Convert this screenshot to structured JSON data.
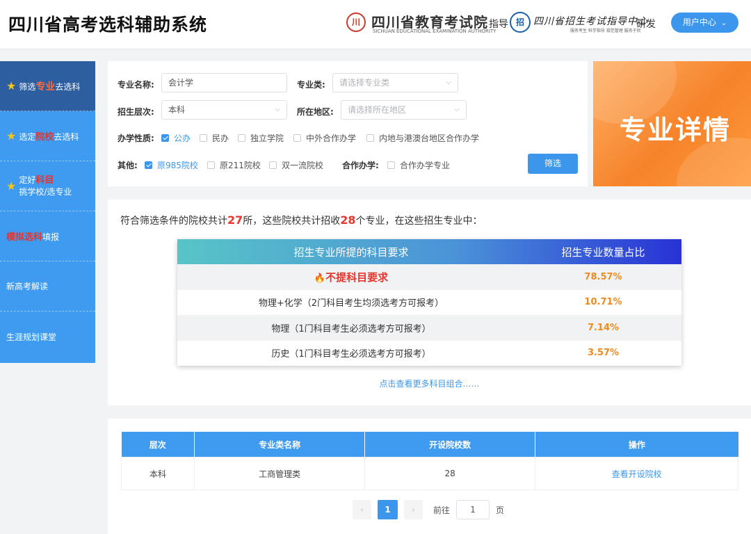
{
  "header": {
    "app_title": "四川省高考选科辅助系统",
    "org1_logo_text": "川",
    "org1_name": "四川省教育考试院",
    "org1_en": "SICHUAN EDUCATIONAL EXAMINATION AUTHORITY",
    "guide_text": "指导",
    "org2_logo_text": "招",
    "org2_name": "四川省招生考试指导中心",
    "org2_sub": "服务考生  科学指导  规范管理  服务于民",
    "develop_text": "研发",
    "user_center_label": "用户中心"
  },
  "sidebar": {
    "items": [
      {
        "prefix": "筛选",
        "highlight": "专业",
        "suffix": "去选科"
      },
      {
        "prefix": "选定",
        "highlight": "院校",
        "suffix": "去选科"
      },
      {
        "prefix": "定好",
        "highlight": "科目",
        "line2": "挑学校/选专业"
      },
      {
        "highlight": "模拟选科",
        "suffix": "填报"
      },
      {
        "label": "新高考解读"
      },
      {
        "label": "生涯规划课堂"
      }
    ]
  },
  "filter": {
    "major_name_label": "专业名称:",
    "major_name_value": "会计学",
    "major_class_label": "专业类:",
    "major_class_placeholder": "请选择专业类",
    "level_label": "招生层次:",
    "level_value": "本科",
    "region_label": "所在地区:",
    "region_placeholder": "请选择所在地区",
    "nature_label": "办学性质:",
    "nature_options": [
      {
        "label": "公办",
        "checked": true
      },
      {
        "label": "民办",
        "checked": false
      },
      {
        "label": "独立学院",
        "checked": false
      },
      {
        "label": "中外合作办学",
        "checked": false
      },
      {
        "label": "内地与港澳台地区合作办学",
        "checked": false
      }
    ],
    "other_label": "其他:",
    "other_options": [
      {
        "label": "原985院校",
        "checked": true
      },
      {
        "label": "原211院校",
        "checked": false
      },
      {
        "label": "双一流院校",
        "checked": false
      }
    ],
    "coop_label": "合作办学:",
    "coop_options": [
      {
        "label": "合作办学专业",
        "checked": false
      }
    ],
    "submit_label": "筛选"
  },
  "banner": {
    "text": "专业详情"
  },
  "summary": {
    "part1": "符合筛选条件的院校共计",
    "school_count": "27",
    "part2": "所，这些院校共计招收",
    "major_count": "28",
    "part3": "个专业，在这些招生专业中："
  },
  "requirements": {
    "header_subject": "招生专业所提的科目要求",
    "header_ratio": "招生专业数量占比",
    "rows": [
      {
        "subject": "不提科目要求",
        "ratio": "78.57%"
      },
      {
        "subject": "物理+化学（2门科目考生均须选考方可报考）",
        "ratio": "10.71%"
      },
      {
        "subject": "物理（1门科目考生必须选考方可报考）",
        "ratio": "7.14%"
      },
      {
        "subject": "历史（1门科目考生必须选考方可报考）",
        "ratio": "3.57%"
      }
    ],
    "more_link": "点击查看更多科目组合……"
  },
  "list": {
    "headers": [
      "层次",
      "专业类名称",
      "开设院校数",
      "操作"
    ],
    "rows": [
      {
        "level": "本科",
        "class_name": "工商管理类",
        "school_count": "28",
        "action": "查看开设院校"
      }
    ]
  },
  "pagination": {
    "prev": "‹",
    "current": "1",
    "next": "›",
    "goto_label": "前往",
    "goto_value": "1",
    "page_unit": "页"
  },
  "icons": {
    "star": "★",
    "fire": "🔥",
    "chevron": "⌵"
  },
  "colors": {
    "primary": "#3c97ec",
    "sidebar_active": "#2d5fa0",
    "accent_red": "#e8342c",
    "accent_orange": "#f08a1d"
  }
}
